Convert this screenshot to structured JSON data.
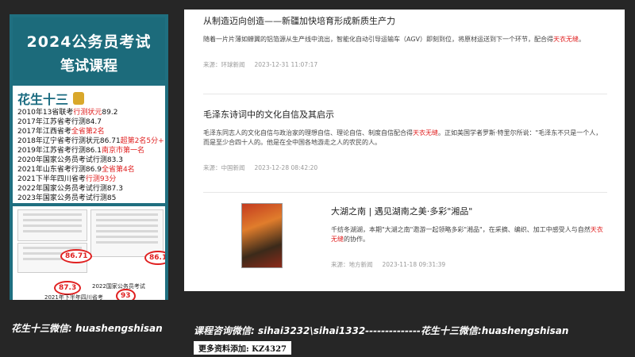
{
  "promo": {
    "title_line1": "2024公务员考试",
    "title_line2": "笔试课程",
    "tutor": "花生十三",
    "records": [
      {
        "text": "2010年13省联考",
        "highlight": "行测状元",
        "tail": "89.2"
      },
      {
        "text": "2017年江苏省考行测84.7",
        "highlight": "",
        "tail": ""
      },
      {
        "text": "2017年江西省考",
        "highlight": "全省第2名",
        "tail": ""
      },
      {
        "text": "2018年辽宁省考行测状元86.71",
        "highlight": "超第2名5分+",
        "tail": ""
      },
      {
        "text": "2019年江苏省考行测86.1",
        "highlight": "南京市第一名",
        "tail": ""
      },
      {
        "text": "2020年国家公务员考试行测83.3",
        "highlight": "",
        "tail": ""
      },
      {
        "text": "2021年山东省考行测86.9",
        "highlight": "全省第4名",
        "tail": ""
      },
      {
        "text": "2021下半年四川省考",
        "highlight": "行测93分",
        "tail": ""
      },
      {
        "text": "2022年国家公务员考试行测87.3",
        "highlight": "",
        "tail": ""
      },
      {
        "text": "2023年国家公务员考试行测85",
        "highlight": "",
        "tail": ""
      }
    ],
    "score_87": "87.3",
    "score_93": "93",
    "score_861": "86.1",
    "score_8671": "86.71",
    "img_label_2022": "2022国家公务员考试",
    "img_label_2021": "2021年下半年四川省考",
    "wechat": "花生十三微信: huashengshisan"
  },
  "articles": [
    {
      "title": "从制造迈向创造——新疆加快培育形成新质生产力",
      "text_pre": "随着一片片薄如蝉翼的铝箔源从生产线中流出，智能化自动引导运输车（AGV）即刻到位，将原材运送到下一个环节，配合得",
      "text_hl": "天衣无缝",
      "text_post": "。",
      "source": "来源：环球新闻",
      "date": "2023-12-31 11:07:17"
    },
    {
      "title": "毛泽东诗词中的文化自信及其启示",
      "text_pre": "毛泽东同志人的文化自信与政治家的理想自信、理论自信、制度自信配合得",
      "text_hl": "天衣无缝",
      "text_post": "。正如美国学者罗斯·特里尔所说：\"毛泽东不只是一个人，而是至少合四十人的。他是在全中国各地游走之人的农民的人。",
      "source": "来源：中国新闻",
      "date": "2023-12-28 08:42:20"
    },
    {
      "title": "大湖之南 | 遇见湖南之美·多彩\"湘品\"",
      "text_pre": "千纺冬湖湖，本期\"大湖之南\"邀游一起领略多彩\"湘品\"，在采摘、编织、加工中感受人与自然",
      "text_hl": "天衣无缝",
      "text_post": "的协作。",
      "source": "来源：地方新闻",
      "date": "2023-11-18 09:31:39"
    }
  ],
  "footer": {
    "contact": "课程咨询微信: sihai3232\\sihai1332--------------花生十三微信:huashengshisan",
    "more": "更多资料添加: KZ4327"
  }
}
